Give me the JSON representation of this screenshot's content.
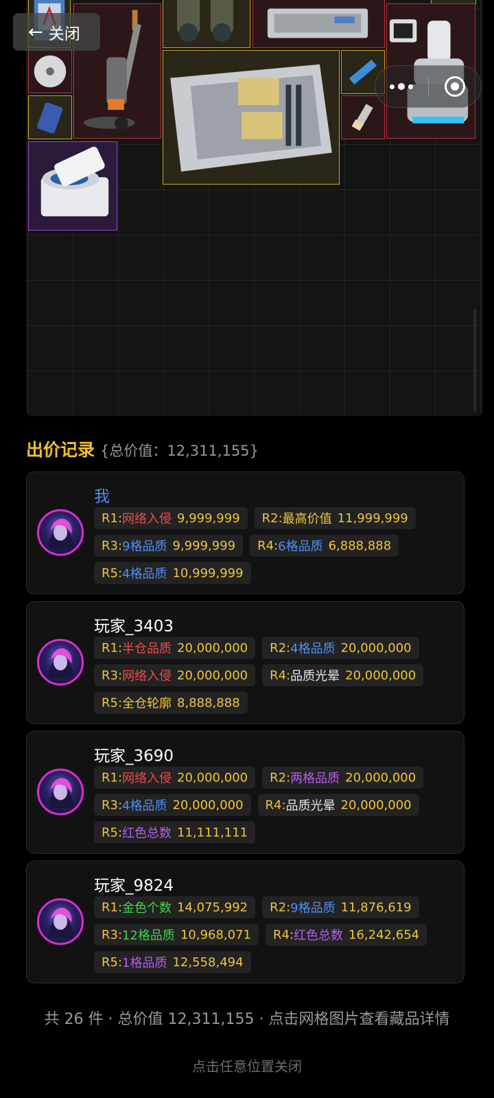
{
  "top_bar": {
    "close_label": "关闭",
    "back_arrow": "←",
    "more_icon": "more-dots-icon",
    "target_icon": "record-target-icon"
  },
  "inventory": {
    "items": [
      {
        "name": "blue-card-item",
        "quality": "gold"
      },
      {
        "name": "vacuum-cleaner-item",
        "quality": "red"
      },
      {
        "name": "binoculars-item",
        "quality": "gold"
      },
      {
        "name": "graphics-card-item",
        "quality": "red"
      },
      {
        "name": "robot-arm-item",
        "quality": "red"
      },
      {
        "name": "cd-disc-item",
        "quality": "red"
      },
      {
        "name": "server-chassis-item",
        "quality": "gold"
      },
      {
        "name": "ram-stick-item",
        "quality": "gold"
      },
      {
        "name": "phone-item",
        "quality": "gold"
      },
      {
        "name": "usb-drive-item",
        "quality": "red"
      },
      {
        "name": "centrifuge-item",
        "quality": "purple"
      }
    ]
  },
  "bids": {
    "title": "出价记录",
    "total_label": "{总价值：12,311,155}",
    "players": [
      {
        "name": "我",
        "is_me": true,
        "rows": [
          [
            {
              "key": "R1:",
              "tag": "网络入侵",
              "tag_color": "red",
              "value": "9,999,999"
            },
            {
              "key": "R2:",
              "tag": "最高价值",
              "tag_color": "gold",
              "value": "11,999,999"
            }
          ],
          [
            {
              "key": "R3:",
              "tag": "9格品质",
              "tag_color": "blue",
              "value": "9,999,999"
            },
            {
              "key": "R4:",
              "tag": "6格品质",
              "tag_color": "blue",
              "value": "6,888,888"
            }
          ],
          [
            {
              "key": "R5:",
              "tag": "4格品质",
              "tag_color": "blue",
              "value": "10,999,999"
            }
          ]
        ]
      },
      {
        "name": "玩家_3403",
        "is_me": false,
        "rows": [
          [
            {
              "key": "R1:",
              "tag": "半仓品质",
              "tag_color": "red",
              "value": "20,000,000"
            },
            {
              "key": "R2:",
              "tag": "4格品质",
              "tag_color": "blue",
              "value": "20,000,000"
            }
          ],
          [
            {
              "key": "R3:",
              "tag": "网络入侵",
              "tag_color": "red",
              "value": "20,000,000"
            },
            {
              "key": "R4:",
              "tag": "品质光晕",
              "tag_color": "white",
              "value": "20,000,000"
            }
          ],
          [
            {
              "key": "R5:",
              "tag": "全仓轮廓",
              "tag_color": "gold",
              "value": "8,888,888"
            }
          ]
        ]
      },
      {
        "name": "玩家_3690",
        "is_me": false,
        "rows": [
          [
            {
              "key": "R1:",
              "tag": "网络入侵",
              "tag_color": "red",
              "value": "20,000,000"
            },
            {
              "key": "R2:",
              "tag": "两格品质",
              "tag_color": "purple",
              "value": "20,000,000"
            }
          ],
          [
            {
              "key": "R3:",
              "tag": "4格品质",
              "tag_color": "blue",
              "value": "20,000,000"
            },
            {
              "key": "R4:",
              "tag": "品质光晕",
              "tag_color": "white",
              "value": "20,000,000"
            }
          ],
          [
            {
              "key": "R5:",
              "tag": "红色总数",
              "tag_color": "purple",
              "value": "11,111,111"
            }
          ]
        ]
      },
      {
        "name": "玩家_9824",
        "is_me": false,
        "rows": [
          [
            {
              "key": "R1:",
              "tag": "金色个数",
              "tag_color": "green",
              "value": "14,075,992"
            },
            {
              "key": "R2:",
              "tag": "9格品质",
              "tag_color": "blue",
              "value": "11,876,619"
            }
          ],
          [
            {
              "key": "R3:",
              "tag": "12格品质",
              "tag_color": "green",
              "value": "10,968,071"
            },
            {
              "key": "R4:",
              "tag": "红色总数",
              "tag_color": "purple",
              "value": "16,242,654"
            }
          ],
          [
            {
              "key": "R5:",
              "tag": "1格品质",
              "tag_color": "purple",
              "value": "12,558,494"
            }
          ]
        ]
      }
    ]
  },
  "footer": {
    "summary": "共 26 件 · 总价值 12,311,155 · 点击网格图片查看藏品详情",
    "tap_close": "点击任意位置关闭"
  },
  "colors": {
    "gold": "#f0c53a",
    "red": "#ef4b4b",
    "blue": "#4d8ef5",
    "purple": "#b45df0",
    "green": "#42d24a",
    "avatar_ring": "#d62fd0"
  }
}
